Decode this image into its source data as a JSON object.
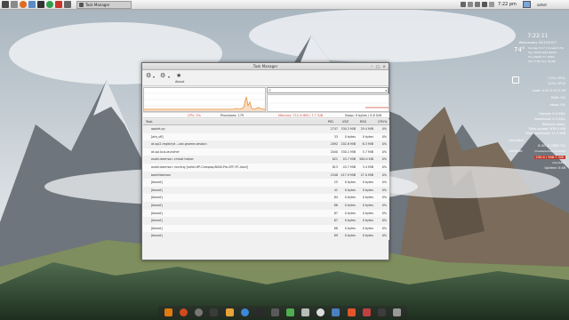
{
  "task_manager": {
    "title": "Task Manager",
    "toolbar": {
      "about_label": "About"
    },
    "status": {
      "cpu": "CPU: 2%",
      "processes": "Processes: 179",
      "memory": "Memory: 712.4 MiB / 7.7 GiB",
      "swap": "Swap: 0 bytes / 5.8 GiB"
    },
    "columns": {
      "task": "Task",
      "pid": "PID",
      "vsz": "VSZ",
      "rss": "RSS",
      "cpu": "CPU%"
    },
    "rows": [
      {
        "task": "applet.py",
        "pid": "2747",
        "vsz": "330.3 MiB",
        "rss": "29.4 MiB",
        "cpu": "0%"
      },
      {
        "task": "[ata_sff]",
        "pid": "33",
        "vsz": "0 bytes",
        "rss": "0 bytes",
        "cpu": "0%"
      },
      {
        "task": "at-spi2-registryd --use-gnome-session",
        "pid": "2092",
        "vsz": "202.8 MiB",
        "rss": "6.3 MiB",
        "cpu": "0%"
      },
      {
        "task": "at-spi-bus-launcher",
        "pid": "2040",
        "vsz": "330.1 MiB",
        "rss": "5.7 MiB",
        "cpu": "0%"
      },
      {
        "task": "avahi-daemon: chroot helper",
        "pid": "821",
        "vsz": "43.7 MiB",
        "rss": "580.0 KiB",
        "cpu": "0%"
      },
      {
        "task": "avahi-daemon: running [sohel-HP-Compaq-8000-Pro-SFF-PC.local]",
        "pid": "813",
        "vsz": "43.7 MiB",
        "rss": "3.4 MiB",
        "cpu": "0%"
      },
      {
        "task": "bamfdaemon",
        "pid": "2548",
        "vsz": "417.9 MiB",
        "rss": "27.0 MiB",
        "cpu": "0%"
      },
      {
        "task": "[bioset]",
        "pid": "25",
        "vsz": "0 bytes",
        "rss": "0 bytes",
        "cpu": "0%"
      },
      {
        "task": "[bioset]",
        "pid": "41",
        "vsz": "0 bytes",
        "rss": "0 bytes",
        "cpu": "0%"
      },
      {
        "task": "[bioset]",
        "pid": "84",
        "vsz": "0 bytes",
        "rss": "0 bytes",
        "cpu": "0%"
      },
      {
        "task": "[bioset]",
        "pid": "86",
        "vsz": "0 bytes",
        "rss": "0 bytes",
        "cpu": "0%"
      },
      {
        "task": "[bioset]",
        "pid": "87",
        "vsz": "0 bytes",
        "rss": "0 bytes",
        "cpu": "0%"
      },
      {
        "task": "[bioset]",
        "pid": "87",
        "vsz": "0 bytes",
        "rss": "0 bytes",
        "cpu": "0%"
      },
      {
        "task": "[bioset]",
        "pid": "88",
        "vsz": "0 bytes",
        "rss": "0 bytes",
        "cpu": "0%"
      },
      {
        "task": "[bioset]",
        "pid": "89",
        "vsz": "0 bytes",
        "rss": "0 bytes",
        "cpu": "0%"
      }
    ]
  },
  "top_panel": {
    "task_label": "Task Manager",
    "clock": "7:22 pm",
    "user": "sohel"
  },
  "conky": {
    "time": "7:22:11",
    "date": "Wednesday 05/10/2017",
    "temp": "74°",
    "sun": "Sunrise 5:17 / Sunset 6:50",
    "lines": [
      "Tue 78/56 Wed 80/59",
      "Thu 82/60 Fri 79/58",
      "Sat 77/57 Sun 81/60"
    ],
    "cpu1": "7.0% CPU1",
    "cpu2": "3.0% CPU2",
    "load": "Load: 0.40 0.45 0.39",
    "ram": "RAM: 9%",
    "swap": "swap: 0%",
    "upload": "Upload: 0.0 KB/s",
    "download": "Download: 0.0 KB/s",
    "network": "Network stats:",
    "totalup": "Total upload: 678.4 KiB",
    "totaldown": "Total download: 11.2 MiB",
    "disk_title": "/dev/sda1",
    "disk_line": "8.4G of 288G 3%",
    "dev2": "/dev/sdb",
    "dev2_line": "/media/sohel/sohel/sdb",
    "dev3": "250.4 / 908.7 GiB",
    "dev3_line": "/dev/sdb1",
    "uptime": "Uptime: 0:48"
  },
  "colors": {
    "panel_bg": "#dcdcdc",
    "cpu_status": "#d54b3a",
    "memory_status": "#d54b3a",
    "graph_line": "#e07a10"
  }
}
